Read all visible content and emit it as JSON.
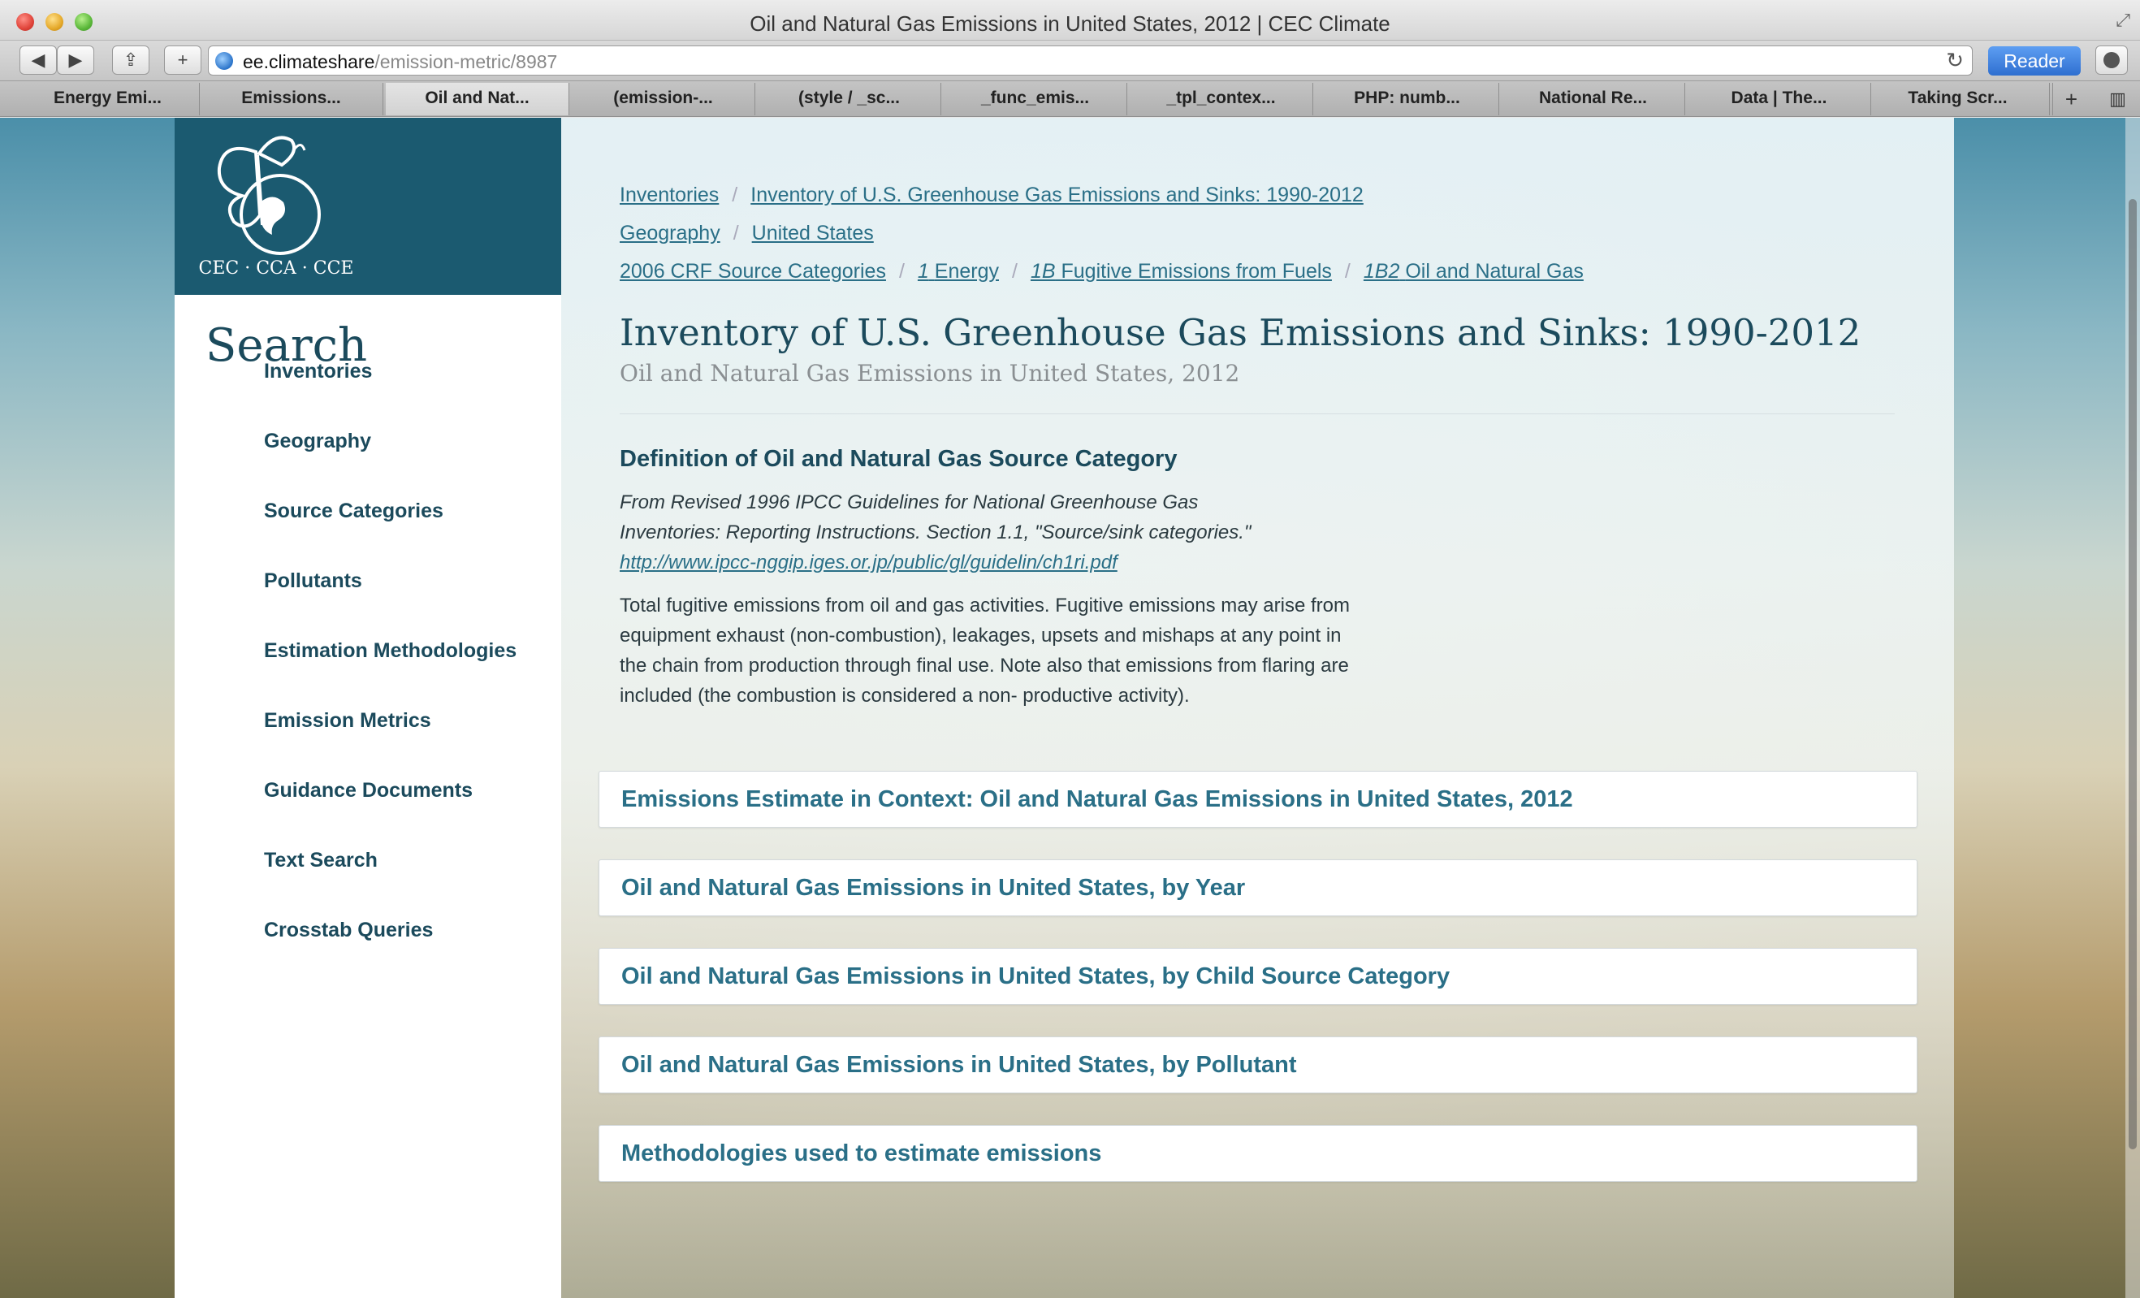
{
  "window": {
    "title": "Oil and Natural Gas Emissions in United States, 2012 | CEC Climate"
  },
  "toolbar": {
    "back_icon": "◀",
    "forward_icon": "▶",
    "share_icon": "⇪",
    "add_icon": "+",
    "url_host": "ee.climateshare",
    "url_path": "/emission-metric/8987",
    "reload_icon": "↻",
    "reader_label": "Reader"
  },
  "tabs": [
    "Energy Emi...",
    "Emissions...",
    "Oil and Nat...",
    "(emission-...",
    "(style / _sc...",
    "_func_emis...",
    "_tpl_contex...",
    "PHP: numb...",
    "National Re...",
    "Data | The...",
    "Taking Scr..."
  ],
  "tab_controls": {
    "new_tab": "+",
    "tab_list": "▥"
  },
  "sidebar": {
    "heading": "Search",
    "items": [
      "Inventories",
      "Geography",
      "Source Categories",
      "Pollutants",
      "Estimation Methodologies",
      "Emission Metrics",
      "Guidance Documents",
      "Text Search",
      "Crosstab Queries"
    ]
  },
  "breadcrumbs": {
    "inventory": [
      "Inventories",
      "Inventory of U.S. Greenhouse Gas Emissions and Sinks: 1990-2012"
    ],
    "geography": [
      "Geography",
      "United States"
    ],
    "source": {
      "root": "2006 CRF Source Categories",
      "levels": [
        {
          "code": "1",
          "label": "Energy"
        },
        {
          "code": "1B",
          "label": "Fugitive Emissions from Fuels"
        },
        {
          "code": "1B2",
          "label": "Oil and Natural Gas"
        }
      ]
    },
    "separator": "/"
  },
  "main": {
    "title": "Inventory of U.S. Greenhouse Gas Emissions and Sinks: 1990-2012",
    "subtitle": "Oil and Natural Gas Emissions in United States, 2012",
    "definition": {
      "heading": "Definition of Oil and Natural Gas Source Category",
      "source_line1": "From Revised 1996 IPCC Guidelines for National Greenhouse Gas",
      "source_line2": "Inventories: Reporting Instructions. Section 1.1, \"Source/sink categories.\"",
      "source_url": "http://www.ipcc-nggip.iges.or.jp/public/gl/guidelin/ch1ri.pdf",
      "body": "Total fugitive emissions from oil and gas activities. Fugitive emissions may arise from equipment exhaust (non-combustion), leakages, upsets and mishaps at any point in the chain from production through final use. Note also that emissions from flaring are included (the combustion is considered a non- productive activity)."
    },
    "panels": [
      "Emissions Estimate in Context: Oil and Natural Gas Emissions in United States, 2012",
      "Oil and Natural Gas Emissions in United States, by Year",
      "Oil and Natural Gas Emissions in United States, by Child Source Category",
      "Oil and Natural Gas Emissions in United States, by Pollutant",
      "Methodologies used to estimate emissions"
    ]
  },
  "logo": {
    "text": "CEC · CCA · CCE",
    "icon": "butterfly-globe-logo"
  },
  "colors": {
    "brand": "#1b5a70",
    "link": "#2a6f87",
    "heading": "#1b4a5c"
  }
}
